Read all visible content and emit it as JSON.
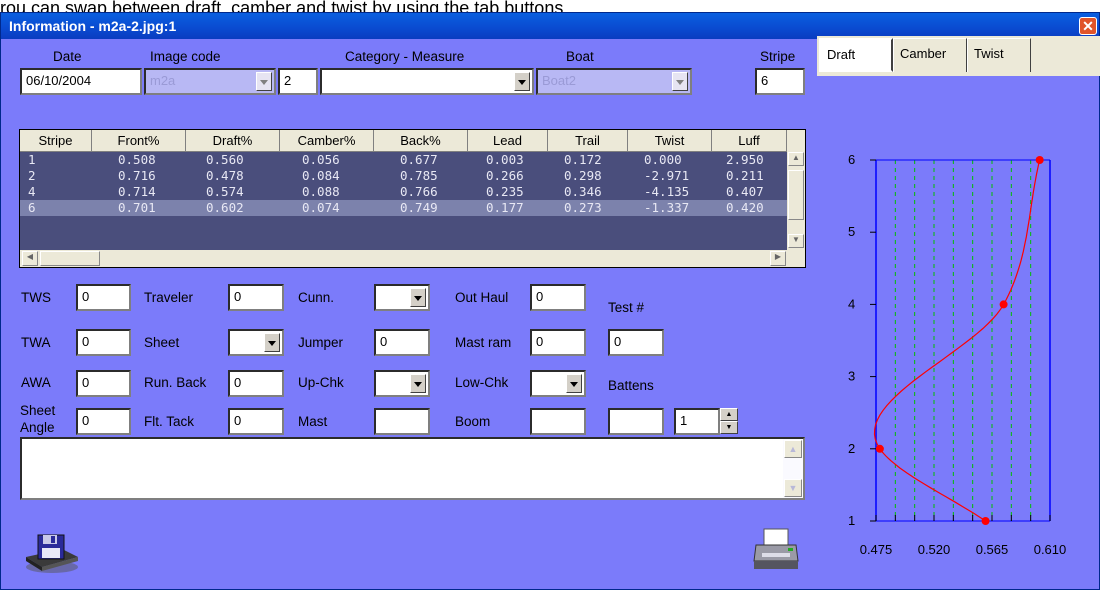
{
  "clipped_text": "rou can swap between draft, camber and twist by using the tab buttons",
  "window": {
    "title": "Information - m2a-2.jpg:1",
    "close_glyph": "✕"
  },
  "header": {
    "date_label": "Date",
    "date_value": "06/10/2004",
    "image_code_label": "Image code",
    "image_code_value": "m2a",
    "image_code_num": "2",
    "category_label": "Category - Measure",
    "category_value": "",
    "boat_label": "Boat",
    "boat_value": "Boat2",
    "stripe_label": "Stripe",
    "stripe_value": "6"
  },
  "tabs": [
    {
      "label": "Draft",
      "active": true
    },
    {
      "label": "Camber",
      "active": false
    },
    {
      "label": "Twist",
      "active": false
    }
  ],
  "grid": {
    "columns": [
      "Stripe",
      "Front%",
      "Draft%",
      "Camber%",
      "Back%",
      "Lead",
      "Trail",
      "Twist",
      "Luff"
    ],
    "rows": [
      [
        "1",
        "0.508",
        "0.560",
        "0.056",
        "0.677",
        "0.003",
        "0.172",
        "0.000",
        "2.950"
      ],
      [
        "2",
        "0.716",
        "0.478",
        "0.084",
        "0.785",
        "0.266",
        "0.298",
        "-2.971",
        "0.211"
      ],
      [
        "4",
        "0.714",
        "0.574",
        "0.088",
        "0.766",
        "0.235",
        "0.346",
        "-4.135",
        "0.407"
      ],
      [
        "6",
        "0.701",
        "0.602",
        "0.074",
        "0.749",
        "0.177",
        "0.273",
        "-1.337",
        "0.420"
      ]
    ],
    "selected_row": 3
  },
  "form": {
    "tws_label": "TWS",
    "tws_value": "0",
    "twa_label": "TWA",
    "twa_value": "0",
    "awa_label": "AWA",
    "awa_value": "0",
    "sheet_angle_label": "Sheet Angle",
    "sheet_angle_value": "0",
    "traveler_label": "Traveler",
    "traveler_value": "0",
    "sheet_label": "Sheet",
    "sheet_value": "",
    "run_back_label": "Run. Back",
    "run_back_value": "0",
    "flt_tack_label": "Flt. Tack",
    "flt_tack_value": "0",
    "cunn_label": "Cunn.",
    "cunn_value": "",
    "jumper_label": "Jumper",
    "jumper_value": "0",
    "up_chk_label": "Up-Chk",
    "up_chk_value": "",
    "mast_label": "Mast",
    "mast_value": "",
    "out_haul_label": "Out Haul",
    "out_haul_value": "0",
    "mast_ram_label": "Mast ram",
    "mast_ram_value": "0",
    "low_chk_label": "Low-Chk",
    "low_chk_value": "",
    "boom_label": "Boom",
    "boom_value": "",
    "test_label": "Test #",
    "test_value": "0",
    "battens_label": "Battens",
    "battens_value": "",
    "battens_count": "1"
  },
  "memo": {
    "text": ""
  },
  "icons": {
    "save": "floppy-save-icon",
    "print": "printer-icon"
  },
  "colors": {
    "window_bg": "#7b7bfa",
    "grid_bg": "#4a4e7c",
    "curve": "#ff0000",
    "grid_lines": "#00c000",
    "axis": "#0000ff"
  },
  "chart_data": {
    "type": "line",
    "x_ticks": [
      "0.475",
      "0.520",
      "0.565",
      "0.610"
    ],
    "y_ticks": [
      "1",
      "2",
      "3",
      "4",
      "5",
      "6"
    ],
    "xlim": [
      0.475,
      0.61
    ],
    "ylim": [
      1,
      6
    ],
    "points": [
      {
        "x": 0.56,
        "y": 1
      },
      {
        "x": 0.478,
        "y": 2
      },
      {
        "x": 0.574,
        "y": 4
      },
      {
        "x": 0.602,
        "y": 6
      }
    ]
  }
}
